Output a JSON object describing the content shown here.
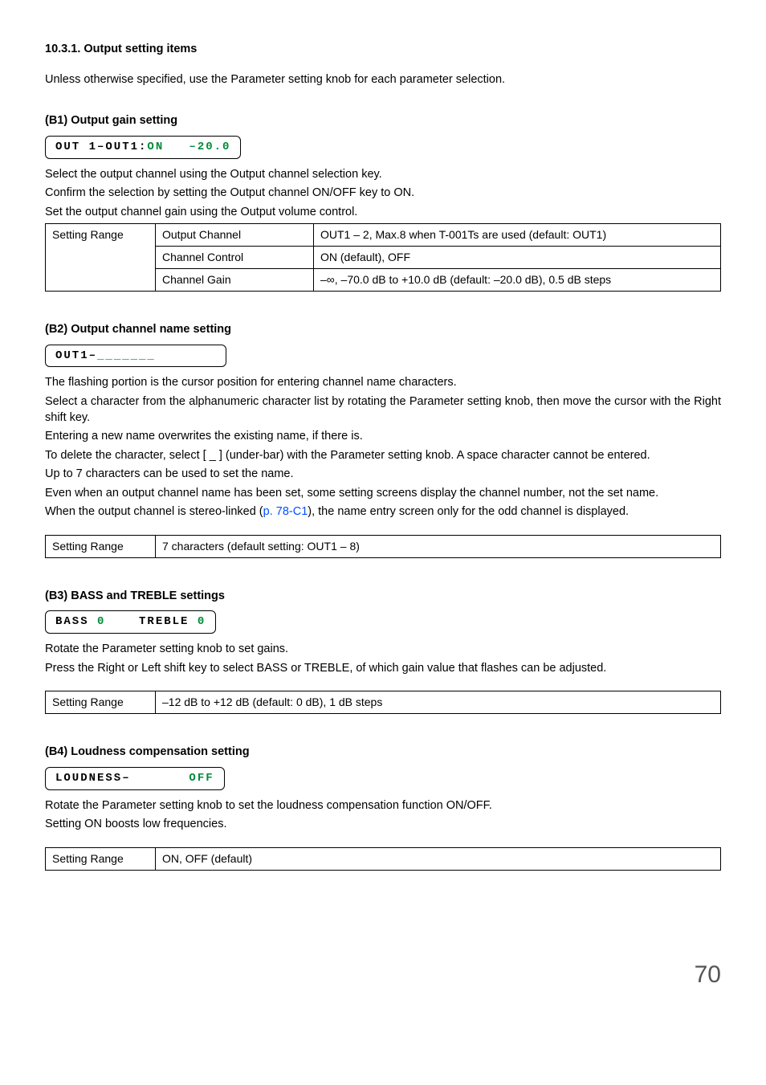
{
  "s_10_3_1": {
    "title": "10.3.1. Output setting items",
    "intro": "Unless otherwise specified, use the Parameter setting knob for each parameter selection."
  },
  "b1": {
    "title": "(B1) Output gain setting",
    "disp_pre": "OUT 1–OUT1:",
    "disp_green": "ON   –20.0",
    "p1": "Select the output channel using the Output channel selection key.",
    "p2": "Confirm the selection by setting the Output channel ON/OFF key to ON.",
    "p3": "Set the output channel gain using the Output volume control.",
    "t_r1c1": "Setting Range",
    "t_r1c2": "Output Channel",
    "t_r1c3": "OUT1 – 2, Max.8 when T-001Ts are used (default: OUT1)",
    "t_r2c2": "Channel Control",
    "t_r2c3": "ON (default), OFF",
    "t_r3c2": "Channel Gain",
    "t_r3c3": "–∞, –70.0 dB to +10.0 dB (default: –20.0 dB), 0.5 dB steps"
  },
  "b2": {
    "title": "(B2) Output channel name setting",
    "disp_pre": "OUT1–",
    "disp_green": "_______",
    "p1": "The flashing portion is the cursor position for entering channel name characters.",
    "p2": "Select a character from the alphanumeric character list by rotating the Parameter setting knob, then move the cursor with the Right shift key.",
    "p3": "Entering a new name overwrites the existing name, if there is.",
    "p4": "To delete the character, select [ _ ] (under-bar) with the Parameter setting knob. A space character cannot be entered.",
    "p5": "Up to 7 characters can be used to set the name.",
    "p6": "Even when an output channel name has been set, some setting screens display the channel number, not the set name.",
    "p7a": "When the output channel is stereo-linked (",
    "p7_link": "p. 78-C1",
    "p7b": "), the name entry screen only for the odd channel is displayed.",
    "t_c1": "Setting Range",
    "t_c2": "7 characters (default setting: OUT1 – 8)"
  },
  "b3": {
    "title": "(B3) BASS and TREBLE settings",
    "disp_l1": "BASS ",
    "disp_v1": "0",
    "disp_l2": "    TREBLE ",
    "disp_v2": "0",
    "p1": "Rotate the Parameter setting knob to set gains.",
    "p2": "Press the Right or Left shift key to select BASS or TREBLE, of which gain value that flashes can be adjusted.",
    "t_c1": "Setting Range",
    "t_c2": "–12 dB to +12 dB (default: 0 dB), 1 dB steps"
  },
  "b4": {
    "title": "(B4) Loudness compensation setting",
    "disp_l": "LOUDNESS–       ",
    "disp_v": "OFF",
    "p1": "Rotate the Parameter setting knob to set the loudness compensation function ON/OFF.",
    "p2": "Setting ON boosts low frequencies.",
    "t_c1": "Setting Range",
    "t_c2": "ON, OFF (default)"
  },
  "page_num": "70"
}
